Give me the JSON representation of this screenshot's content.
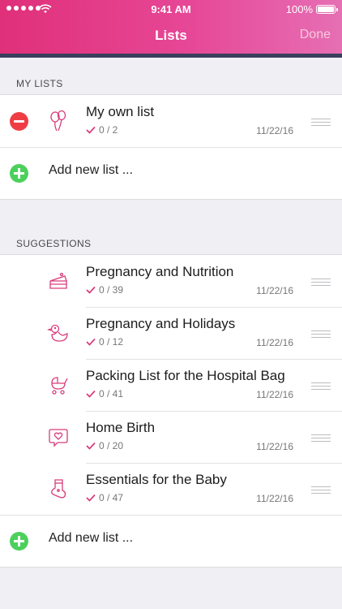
{
  "status_bar": {
    "time": "9:41 AM",
    "battery": "100%"
  },
  "nav": {
    "title": "Lists",
    "done_label": "Done"
  },
  "colors": {
    "accent": "#e0307a",
    "remove": "#ee3e43",
    "add": "#4cd05c"
  },
  "my_lists": {
    "header": "MY LISTS",
    "items": [
      {
        "title": "My own list",
        "progress": "0 / 2",
        "date": "11/22/16",
        "icon": "balloons-icon"
      }
    ],
    "add_label": "Add new list ..."
  },
  "suggestions": {
    "header": "SUGGESTIONS",
    "items": [
      {
        "title": "Pregnancy and Nutrition",
        "progress": "0 / 39",
        "date": "11/22/16",
        "icon": "cake-icon"
      },
      {
        "title": "Pregnancy and Holidays",
        "progress": "0 / 12",
        "date": "11/22/16",
        "icon": "rubber-duck-icon"
      },
      {
        "title": "Packing List for the Hospital Bag",
        "progress": "0 / 41",
        "date": "11/22/16",
        "icon": "stroller-icon"
      },
      {
        "title": "Home Birth",
        "progress": "0 / 20",
        "date": "11/22/16",
        "icon": "heart-bubble-icon"
      },
      {
        "title": "Essentials for the Baby",
        "progress": "0 / 47",
        "date": "11/22/16",
        "icon": "baby-sock-icon"
      }
    ],
    "add_label": "Add new list ..."
  }
}
